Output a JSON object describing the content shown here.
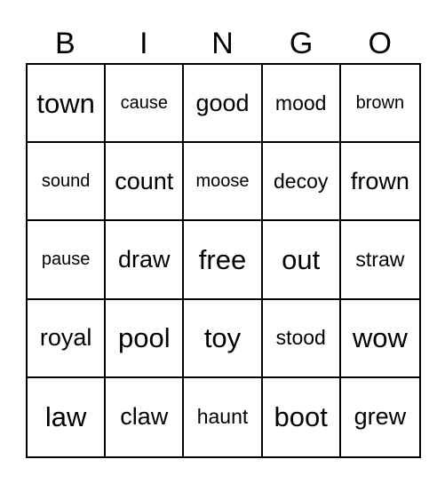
{
  "header": {
    "letters": [
      "B",
      "I",
      "N",
      "G",
      "O"
    ]
  },
  "board": {
    "rows": [
      [
        "town",
        "cause",
        "good",
        "mood",
        "brown"
      ],
      [
        "sound",
        "count",
        "moose",
        "decoy",
        "frown"
      ],
      [
        "pause",
        "draw",
        "free",
        "out",
        "straw"
      ],
      [
        "royal",
        "pool",
        "toy",
        "stood",
        "wow"
      ],
      [
        "law",
        "claw",
        "haunt",
        "boot",
        "grew"
      ]
    ]
  }
}
